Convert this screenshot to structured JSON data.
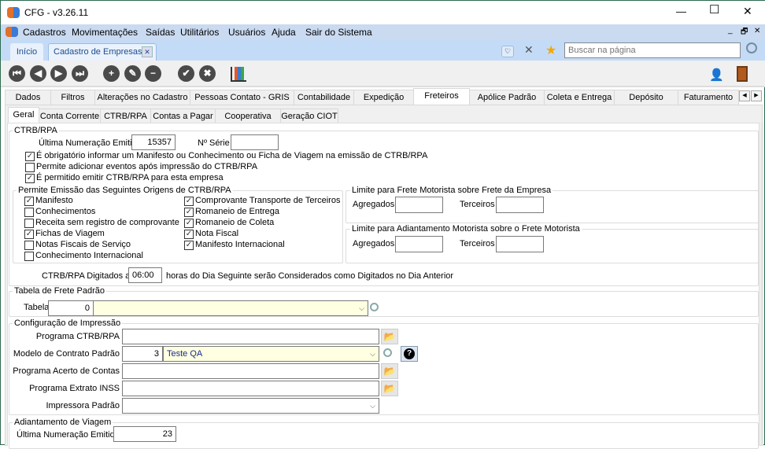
{
  "window": {
    "title": "CFG - v3.26.11",
    "minimize": "—",
    "maximize": "☐",
    "close": "✕"
  },
  "menu": [
    "Cadastros",
    "Movimentações",
    "Saídas",
    "Utilitários",
    "Usuários",
    "Ajuda",
    "Sair do Sistema"
  ],
  "mdi_controls": [
    "_",
    "🗗",
    "✕"
  ],
  "page_tabs": {
    "home": "Início",
    "current": "Cadastro de Empresas"
  },
  "search": {
    "placeholder": "Buscar na página"
  },
  "main_tabs": [
    "Dados",
    "Filtros",
    "Alterações no Cadastro",
    "Pessoas Contato - GRIS",
    "Contabilidade",
    "Expedição",
    "Freteiros",
    "Apólice Padrão",
    "Coleta e Entrega",
    "Depósito",
    "Faturamento"
  ],
  "active_main_tab": "Freteiros",
  "sub_tabs": [
    "Geral",
    "Conta Corrente",
    "CTRB/RPA",
    "Contas a Pagar",
    "Cooperativa",
    "Geração CIOT"
  ],
  "active_sub_tab": "Geral",
  "ctrb": {
    "legend": "CTRB/RPA",
    "ultima_label": "Última Numeração Emitida",
    "ultima_value": "15357",
    "serie_label": "Nº Série",
    "serie_value": "",
    "options": [
      {
        "label": "É obrigatório informar um Manifesto ou Conhecimento ou Ficha de Viagem na emissão de CTRB/RPA",
        "checked": true
      },
      {
        "label": "Permite adicionar eventos após impressão do CTRB/RPA",
        "checked": false
      },
      {
        "label": "É permitido emitir CTRB/RPA para esta empresa",
        "checked": true
      }
    ],
    "origens_legend": "Permite Emissão das Seguintes Origens de CTRB/RPA",
    "origens_col1": [
      {
        "label": "Manifesto",
        "checked": true
      },
      {
        "label": "Conhecimentos",
        "checked": false
      },
      {
        "label": "Receita sem registro de comprovante",
        "checked": false
      },
      {
        "label": "Fichas de Viagem",
        "checked": true
      },
      {
        "label": "Notas Fiscais de Serviço",
        "checked": false
      },
      {
        "label": "Conhecimento Internacional",
        "checked": false
      }
    ],
    "origens_col2": [
      {
        "label": "Comprovante Transporte de Terceiros",
        "checked": true
      },
      {
        "label": "Romaneio de Entrega",
        "checked": true
      },
      {
        "label": "Romaneio de Coleta",
        "checked": true
      },
      {
        "label": "Nota Fiscal",
        "checked": true
      },
      {
        "label": "Manifesto Internacional",
        "checked": true
      }
    ],
    "limite_frete_legend": "Limite para Frete Motorista sobre Frete da Empresa",
    "limite_adiant_legend": "Limite para Adiantamento Motorista sobre o Frete Motorista",
    "agregados_label": "Agregados",
    "terceiros_label": "Terceiros",
    "digitados_label": "CTRB/RPA Digitados até",
    "digitados_value": "06:00",
    "digitados_suffix": "horas do Dia Seguinte serão Considerados como Digitados no Dia Anterior"
  },
  "tabela_frete": {
    "legend": "Tabela de Frete Padrão",
    "label": "Tabela",
    "code": "0",
    "name": ""
  },
  "impressao": {
    "legend": "Configuração de Impressão",
    "programa_ctrb_label": "Programa CTRB/RPA",
    "programa_ctrb_value": "",
    "modelo_label": "Modelo de Contrato Padrão",
    "modelo_code": "3",
    "modelo_name": "Teste QA",
    "acerto_label": "Programa Acerto de Contas",
    "acerto_value": "",
    "inss_label": "Programa Extrato INSS",
    "inss_value": "",
    "impressora_label": "Impressora Padrão",
    "impressora_value": ""
  },
  "adiantamento": {
    "legend": "Adiantamento de Viagem",
    "label": "Última Numeração Emitida",
    "value": "23"
  }
}
